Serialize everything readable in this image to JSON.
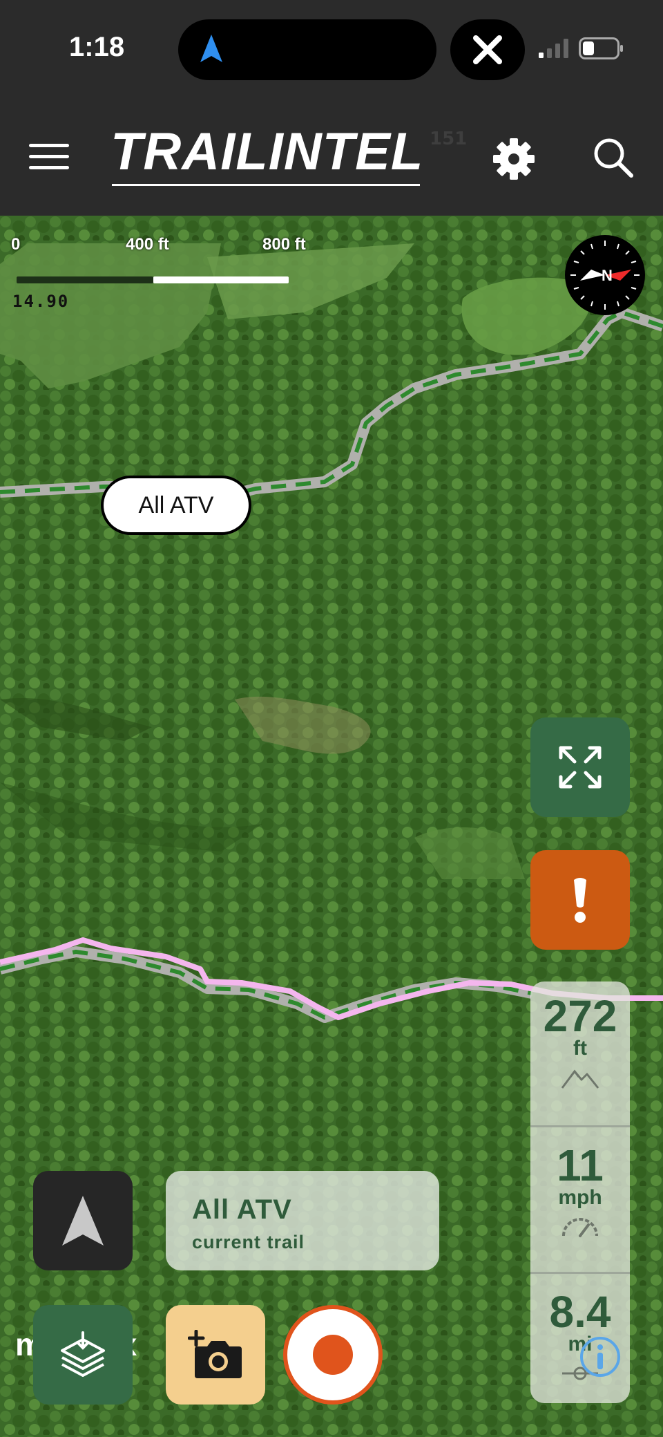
{
  "status_bar": {
    "time": "1:18"
  },
  "header": {
    "logo": "TRAILINTEL",
    "version": "151"
  },
  "map": {
    "scale": {
      "label_0": "0",
      "label_mid": "400 ft",
      "label_max": "800 ft",
      "zoom": "14.90"
    },
    "compass_label": "N",
    "trail_label": "All ATV",
    "attribution": "mapbox"
  },
  "current_trail": {
    "name": "All ATV",
    "subtitle": "current trail"
  },
  "stats": {
    "elevation": {
      "value": "272",
      "unit": "ft",
      "icon": "mountain-icon"
    },
    "speed": {
      "value": "11",
      "unit": "mph",
      "icon": "speedometer-icon"
    },
    "distance": {
      "value": "8.4",
      "unit": "mi",
      "icon": "distance-icon"
    }
  },
  "buttons": {
    "expand": "expand-icon",
    "alert": "!",
    "locate": "navigation-arrow-icon",
    "layers": "layers-icon",
    "camera": "add-photo-icon",
    "record": "record-icon"
  },
  "colors": {
    "header_bg": "#2b2b2b",
    "brand_green": "#356b46",
    "alert_orange": "#cc5a12",
    "record_orange": "#e0541c",
    "camera_yellow": "#f4cf8e",
    "trail_green": "#2e8a2e",
    "trail_pink": "#f4b6ee"
  }
}
